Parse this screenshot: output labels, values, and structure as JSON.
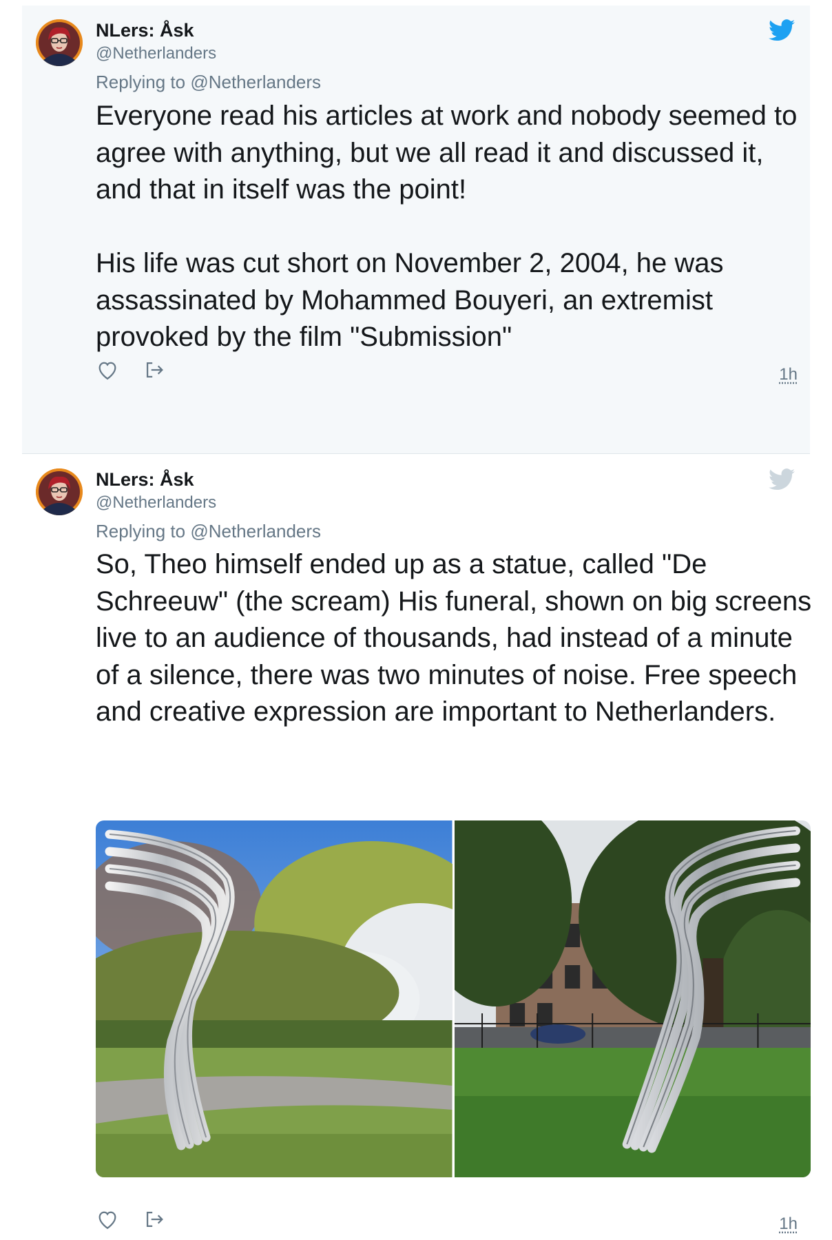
{
  "tweets": [
    {
      "name": "NLers: Åsk",
      "handle": "@Netherlanders",
      "reply_prefix": "Replying to",
      "reply_to": "@Netherlanders",
      "paragraphs": [
        "Everyone read his articles at work and nobody seemed to agree with anything, but we all read it and discussed it, and that in itself was the point!",
        "His life was cut short on November 2, 2004, he was assassinated by Mohammed Bouyeri, an extremist provoked by the film \"Submission\""
      ],
      "timestamp": "1h",
      "bird_icon": "twitter-bird-icon",
      "bird_color": "#1da1f2"
    },
    {
      "name": "NLers: Åsk",
      "handle": "@Netherlanders",
      "reply_prefix": "Replying to",
      "reply_to": "@Netherlanders",
      "paragraphs": [
        "So, Theo himself ended up as a statue, called \"De Schreeuw\" (the scream) His funeral, shown on big screens live to an audience of thousands, had instead of a minute of a silence, there was two minutes of noise. Free speech and creative expression are important to Netherlanders."
      ],
      "timestamp": "1h",
      "bird_icon": "twitter-bird-icon",
      "bird_color": "#ccd6dd"
    }
  ],
  "icons": {
    "like": "heart-icon",
    "share": "share-icon"
  },
  "colors": {
    "text": "#14171a",
    "secondary": "#657786",
    "avatar_ring": "#e8891c",
    "highlight_bg": "#f5f8fa"
  }
}
